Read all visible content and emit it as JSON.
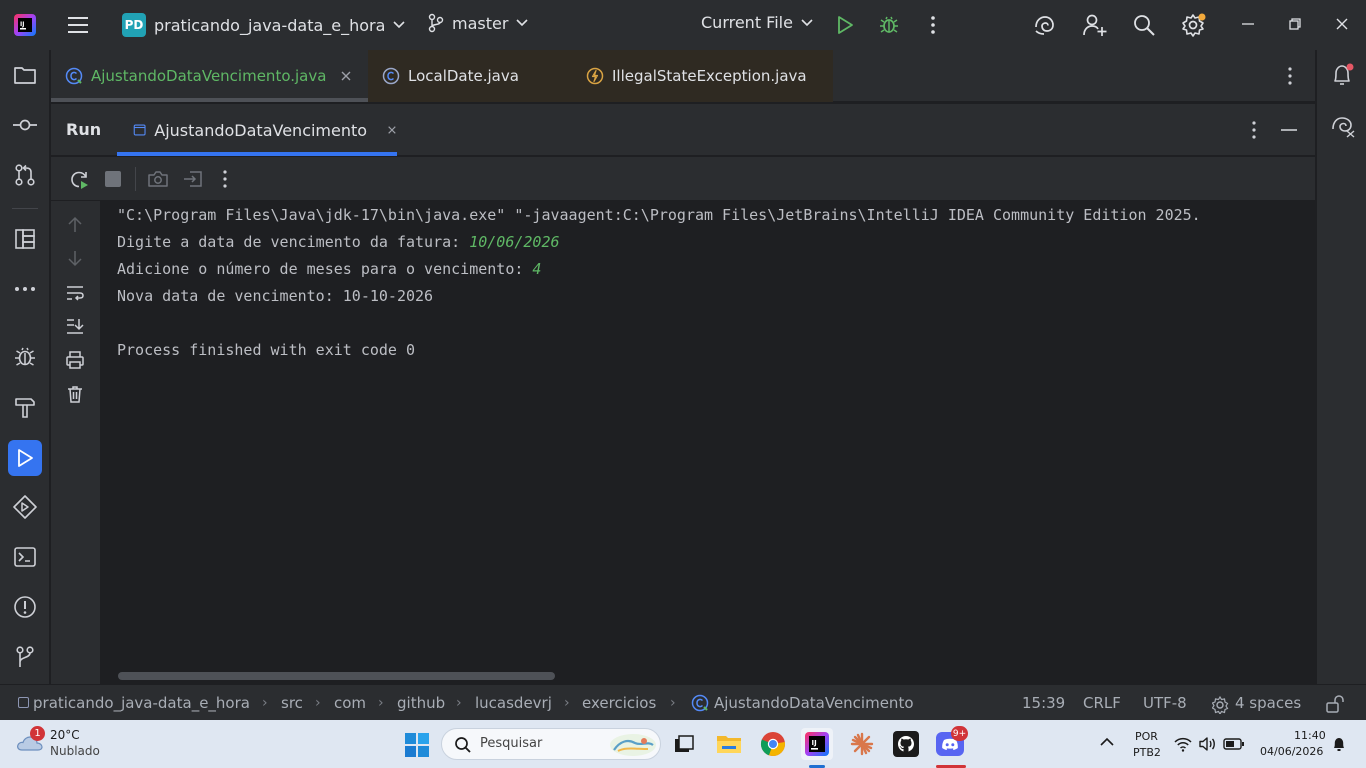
{
  "titlebar": {
    "project_badge": "PD",
    "project_name": "praticando_java-data_e_hora",
    "branch": "master",
    "run_config": "Current File"
  },
  "editor_tabs": [
    {
      "label": "AjustandoDataVencimento.java",
      "active": true
    },
    {
      "label": "LocalDate.java",
      "active": false
    },
    {
      "label": "IllegalStateException.java",
      "active": false
    }
  ],
  "run_panel": {
    "title": "Run",
    "tab_label": "AjustandoDataVencimento"
  },
  "console": {
    "command_line": "\"C:\\Program Files\\Java\\jdk-17\\bin\\java.exe\" \"-javaagent:C:\\Program Files\\JetBrains\\IntelliJ IDEA Community Edition 2025.",
    "prompt1": "Digite a data de vencimento da fatura: ",
    "input1": "10/06/2026",
    "prompt2": "Adicione o número de meses para o vencimento: ",
    "input2": "4",
    "result": "Nova data de vencimento: 10-10-2026",
    "exit": "Process finished with exit code 0"
  },
  "statusbar": {
    "breadcrumbs": [
      "praticando_java-data_e_hora",
      "src",
      "com",
      "github",
      "lucasdevrj",
      "exercicios",
      "AjustandoDataVencimento"
    ],
    "position": "15:39",
    "line_sep": "CRLF",
    "encoding": "UTF-8",
    "indent": "4 spaces"
  },
  "taskbar": {
    "weather_badge": "1",
    "temperature": "20°C",
    "condition": "Nublado",
    "search_placeholder": "Pesquisar",
    "discord_badge": "9+",
    "lang": "POR",
    "layout": "PTB2",
    "time": "11:40",
    "date": "04/06/2026"
  },
  "colors": {
    "accent": "#3574f0",
    "input_green": "#5fb865",
    "project_badge": "#21a2b5"
  }
}
